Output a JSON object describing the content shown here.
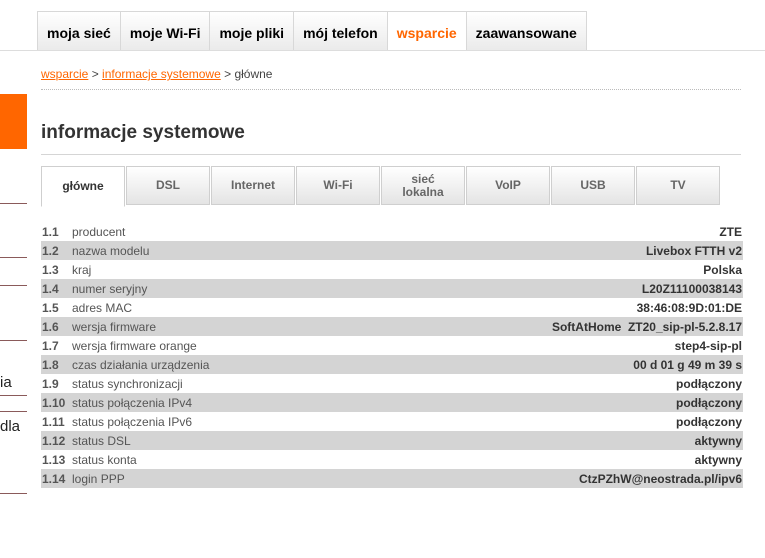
{
  "top_nav": {
    "tabs": [
      {
        "label": "moja sieć"
      },
      {
        "label": "moje Wi-Fi"
      },
      {
        "label": "moje pliki"
      },
      {
        "label": "mój telefon"
      },
      {
        "label": "wsparcie",
        "active": true
      },
      {
        "label": "zaawansowane"
      }
    ]
  },
  "sidebar": {
    "fragments": [
      "ia",
      "dla"
    ]
  },
  "breadcrumb": {
    "link1": "wsparcie",
    "sep1": " > ",
    "link2": "informacje systemowe",
    "sep2": " > ",
    "current": "główne"
  },
  "page_title": "informacje systemowe",
  "sub_tabs": [
    {
      "label": "główne",
      "active": true
    },
    {
      "label": "DSL"
    },
    {
      "label": "Internet"
    },
    {
      "label": "Wi-Fi"
    },
    {
      "label": "sieć lokalna"
    },
    {
      "label": "VoIP"
    },
    {
      "label": "USB"
    },
    {
      "label": "TV"
    }
  ],
  "info_rows": [
    {
      "num": "1.1",
      "label": "producent",
      "value": "ZTE"
    },
    {
      "num": "1.2",
      "label": "nazwa modelu",
      "value": "Livebox FTTH v2"
    },
    {
      "num": "1.3",
      "label": "kraj",
      "value": "Polska"
    },
    {
      "num": "1.4",
      "label": "numer seryjny",
      "value": "L20Z11100038143"
    },
    {
      "num": "1.5",
      "label": "adres MAC",
      "value": "38:46:08:9D:01:DE"
    },
    {
      "num": "1.6",
      "label": "wersja firmware",
      "value": "SoftAtHome  ZT20_sip-pl-5.2.8.17"
    },
    {
      "num": "1.7",
      "label": "wersja firmware orange",
      "value": "step4-sip-pl"
    },
    {
      "num": "1.8",
      "label": "czas działania urządzenia",
      "value": "00 d 01 g 49 m 39 s"
    },
    {
      "num": "1.9",
      "label": "status synchronizacji",
      "value": "podłączony"
    },
    {
      "num": "1.10",
      "label": "status połączenia IPv4",
      "value": "podłączony"
    },
    {
      "num": "1.11",
      "label": "status połączenia IPv6",
      "value": "podłączony"
    },
    {
      "num": "1.12",
      "label": "status DSL",
      "value": "aktywny"
    },
    {
      "num": "1.13",
      "label": "status konta",
      "value": "aktywny"
    },
    {
      "num": "1.14",
      "label": "login PPP",
      "value": "CtzPZhW@neostrada.pl/ipv6"
    }
  ],
  "colors": {
    "accent": "#ff6600",
    "row_shade": "#d4d4d4"
  }
}
